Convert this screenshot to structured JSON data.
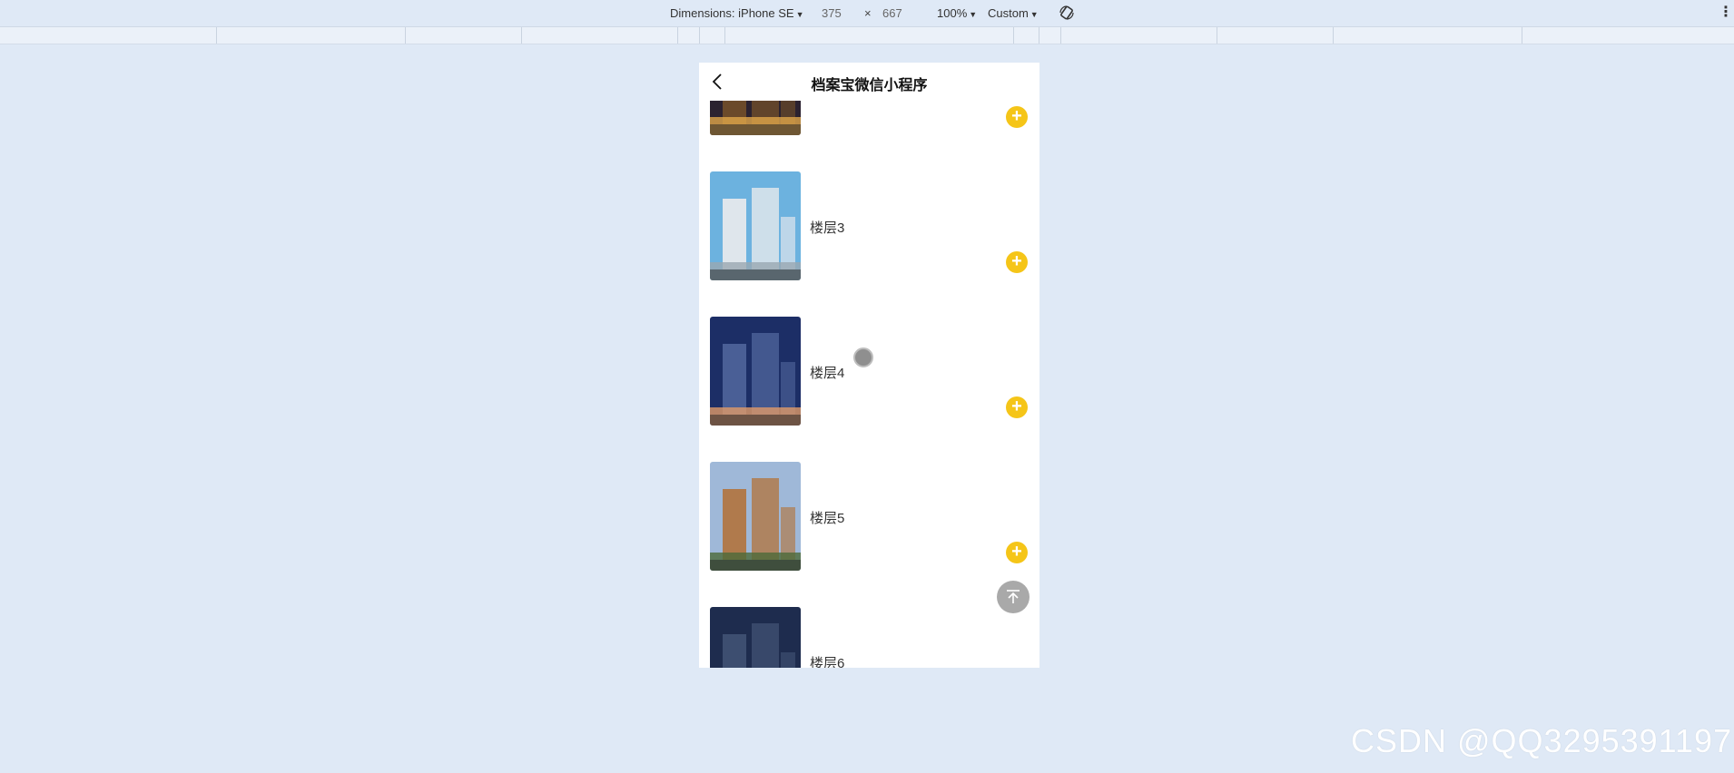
{
  "devtools": {
    "dimensions_label": "Dimensions: iPhone SE",
    "width": "375",
    "times": "×",
    "height": "667",
    "zoom": "100%",
    "throttle": "Custom"
  },
  "app": {
    "title": "档案宝微信小程序"
  },
  "floors": [
    {
      "label": "",
      "colors": {
        "sky": "#2b2230",
        "building": "#6b4a2a",
        "accent": "#e0a64a"
      }
    },
    {
      "label": "楼层3",
      "colors": {
        "sky": "#6cb2df",
        "building": "#dfe6ec",
        "accent": "#9aa7b2"
      }
    },
    {
      "label": "楼层4",
      "colors": {
        "sky": "#1c2e66",
        "building": "#4a5f96",
        "accent": "#e09a68"
      }
    },
    {
      "label": "楼层5",
      "colors": {
        "sky": "#9fb8d8",
        "building": "#b07a4c",
        "accent": "#4c6a3a"
      }
    },
    {
      "label": "楼层6",
      "colors": {
        "sky": "#1e2c4e",
        "building": "#3d4e70",
        "accent": "#d9a04a"
      }
    }
  ],
  "icons": {
    "back": "chevron-left-icon",
    "add": "plus-icon",
    "scroll_top": "arrow-up-to-top-icon",
    "rotate": "rotate-icon",
    "more": "kebab-icon"
  },
  "add_symbol": "+",
  "accent_color": "#f5c518",
  "watermark": "CSDN @QQ3295391197"
}
